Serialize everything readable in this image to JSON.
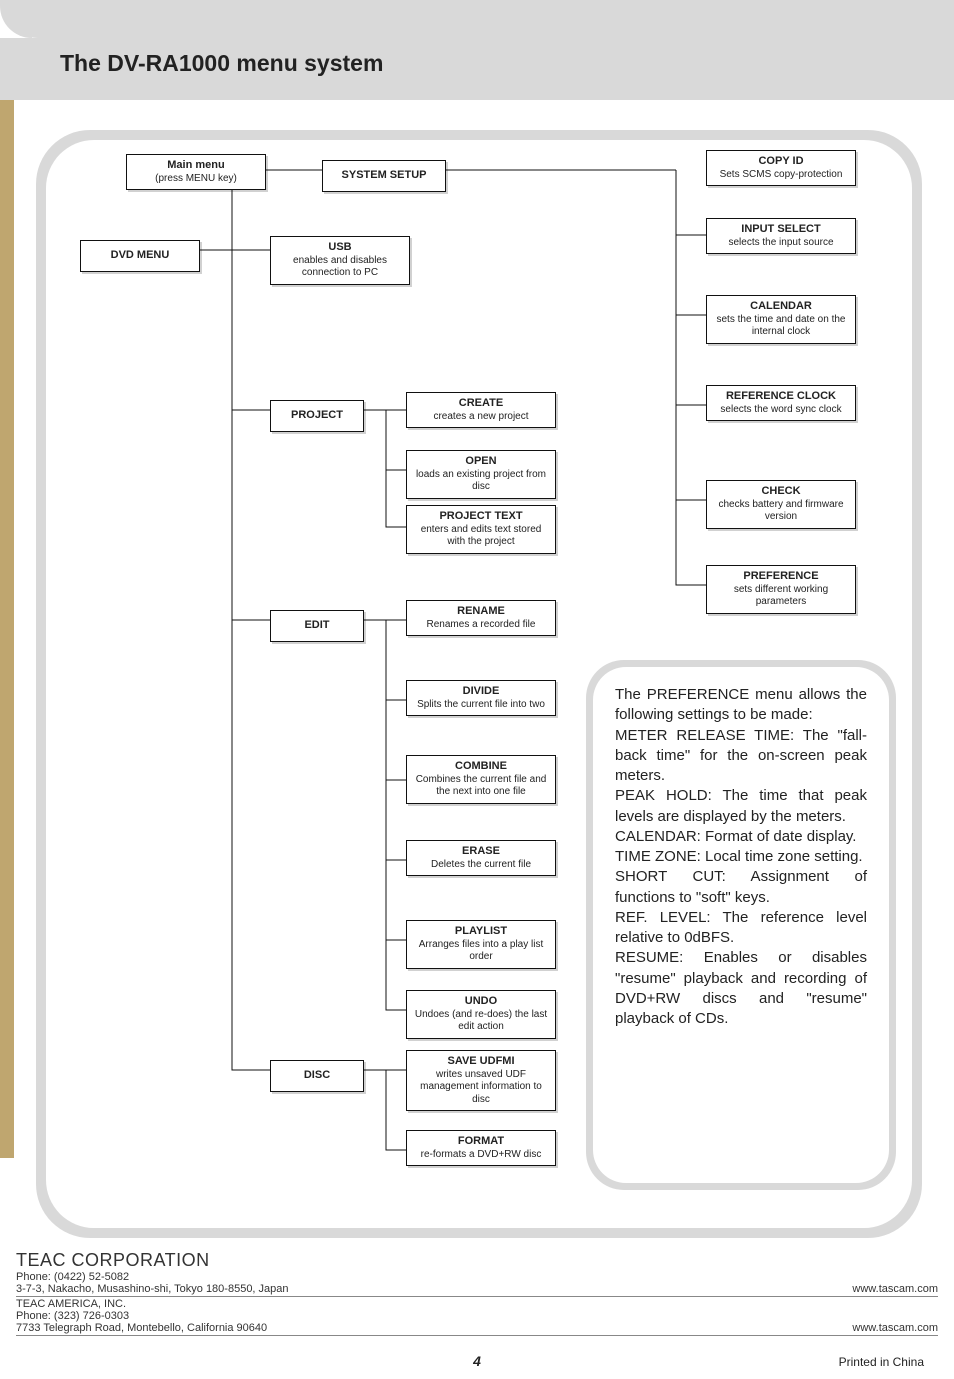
{
  "header": {
    "title": "The DV-RA1000 menu system"
  },
  "nodes": {
    "main_menu": {
      "title": "Main menu",
      "sub": "(press MENU key)"
    },
    "dvd_menu": {
      "title": "DVD MENU",
      "sub": ""
    },
    "system_setup": {
      "title": "SYSTEM SETUP",
      "sub": ""
    },
    "usb": {
      "title": "USB",
      "sub": "enables and disables connection to PC"
    },
    "project": {
      "title": "PROJECT",
      "sub": ""
    },
    "edit": {
      "title": "EDIT",
      "sub": ""
    },
    "disc": {
      "title": "DISC",
      "sub": ""
    },
    "copy_id": {
      "title": "COPY ID",
      "sub": "Sets SCMS copy-protection"
    },
    "input_select": {
      "title": "INPUT SELECT",
      "sub": "selects the input source"
    },
    "calendar": {
      "title": "CALENDAR",
      "sub": "sets the time and date on the internal clock"
    },
    "ref_clock": {
      "title": "REFERENCE CLOCK",
      "sub": "selects the word sync clock"
    },
    "check": {
      "title": "CHECK",
      "sub": "checks battery and firmware version"
    },
    "preference": {
      "title": "PREFERENCE",
      "sub": "sets different working parameters"
    },
    "create": {
      "title": "CREATE",
      "sub": "creates a new project"
    },
    "open": {
      "title": "OPEN",
      "sub": "loads an existing project from disc"
    },
    "project_text": {
      "title": "PROJECT TEXT",
      "sub": "enters and edits text stored with the project"
    },
    "rename": {
      "title": "RENAME",
      "sub": "Renames a recorded file"
    },
    "divide": {
      "title": "DIVIDE",
      "sub": "Splits the current file into two"
    },
    "combine": {
      "title": "COMBINE",
      "sub": "Combines the current file and the next into one file"
    },
    "erase": {
      "title": "ERASE",
      "sub": "Deletes the current file"
    },
    "playlist": {
      "title": "PLAYLIST",
      "sub": "Arranges files into a play list order"
    },
    "undo": {
      "title": "UNDO",
      "sub": "Undoes (and re-does) the last edit action"
    },
    "save_udfmi": {
      "title": "SAVE UDFMI",
      "sub": "writes unsaved UDF management information to disc"
    },
    "format": {
      "title": "FORMAT",
      "sub": "re-formats a DVD+RW disc"
    }
  },
  "info": {
    "p1": "The PREFERENCE menu allows the following settings to be made:",
    "p2": "METER RELEASE TIME: The \"fall-back time\" for the on-screen peak meters.",
    "p3": "PEAK HOLD: The time that peak levels are displayed by the meters.",
    "p4": "CALENDAR: Format of date display.",
    "p5": "TIME ZONE: Local time zone setting.",
    "p6": "SHORT CUT: Assignment of functions to \"soft\" keys.",
    "p7": "REF. LEVEL: The reference level relative to 0dBFS.",
    "p8": "RESUME: Enables or disables \"resume\" playback and recording of DVD+RW discs and \"resume\" playback of CDs."
  },
  "footer": {
    "company": "TEAC CORPORATION",
    "phone1_label": "Phone: (0422) 52-5082",
    "addr1": "3-7-3, Nakacho, Musashino-shi, Tokyo 180-8550, Japan",
    "sub_company": "TEAC AMERICA, INC.",
    "phone2_label": "Phone: (323) 726-0303",
    "addr2": "7733 Telegraph Road, Montebello, California 90640",
    "url": "www.tascam.com",
    "page": "4",
    "printed": "Printed in China"
  }
}
